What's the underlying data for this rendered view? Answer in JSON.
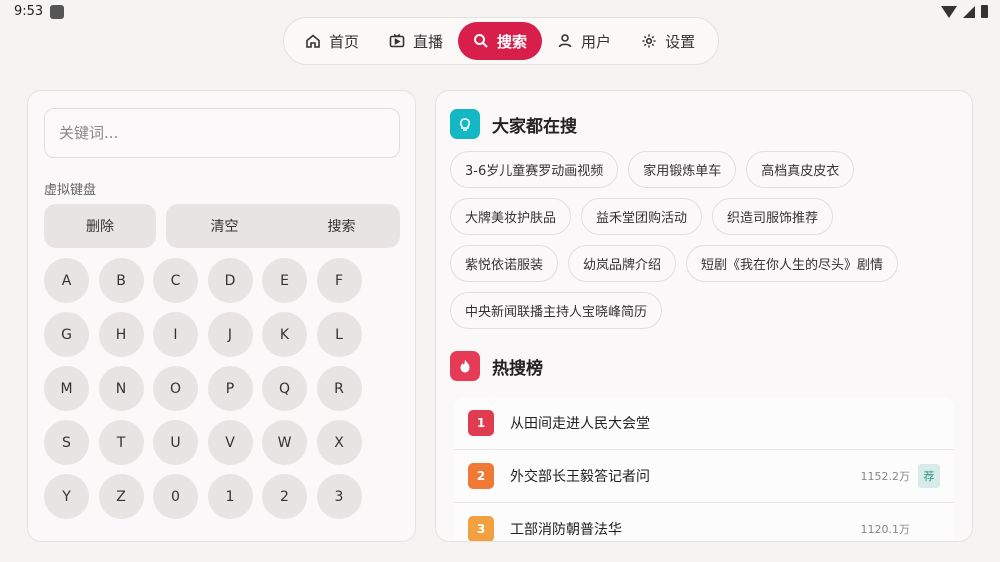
{
  "status": {
    "time": "9:53"
  },
  "nav": {
    "items": [
      {
        "label": "首页",
        "icon": "home-icon"
      },
      {
        "label": "直播",
        "icon": "live-tv-icon"
      },
      {
        "label": "搜索",
        "icon": "search-icon",
        "active": true
      },
      {
        "label": "用户",
        "icon": "user-icon"
      },
      {
        "label": "设置",
        "icon": "gear-icon"
      }
    ]
  },
  "search": {
    "placeholder": "关键词..."
  },
  "keyboard": {
    "title": "虚拟键盘",
    "actions": {
      "delete": "删除",
      "clear": "清空",
      "search": "搜索"
    },
    "keys": [
      "A",
      "B",
      "C",
      "D",
      "E",
      "F",
      "G",
      "H",
      "I",
      "J",
      "K",
      "L",
      "M",
      "N",
      "O",
      "P",
      "Q",
      "R",
      "S",
      "T",
      "U",
      "V",
      "W",
      "X",
      "Y",
      "Z",
      "0",
      "1",
      "2",
      "3"
    ]
  },
  "trending": {
    "title": "大家都在搜",
    "tags": [
      "3-6岁儿童赛罗动画视频",
      "家用锻炼单车",
      "高档真皮皮衣",
      "大牌美妆护肤品",
      "益禾堂团购活动",
      "织造司服饰推荐",
      "紫悦依诺服装",
      "幼岚品牌介绍",
      "短剧《我在你人生的尽头》剧情",
      "中央新闻联播主持人宝晓峰简历"
    ]
  },
  "hot": {
    "title": "热搜榜",
    "items": [
      {
        "rank": "1",
        "title": "从田间走进人民大会堂",
        "count": "",
        "badge": ""
      },
      {
        "rank": "2",
        "title": "外交部长王毅答记者问",
        "count": "1152.2万",
        "badge": "荐"
      },
      {
        "rank": "3",
        "title": "工部消防朝普法华",
        "count": "1120.1万",
        "badge": ""
      }
    ]
  },
  "colors": {
    "accent": "#d81e4a",
    "teal": "#14b8c4",
    "hot_red": "#e63b56"
  }
}
